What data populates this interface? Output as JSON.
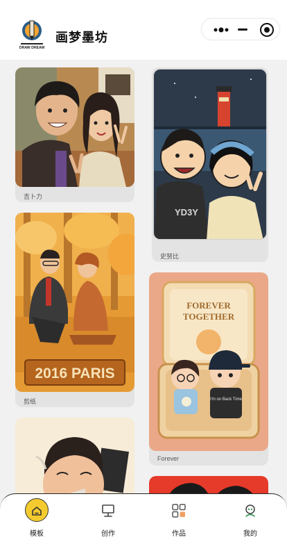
{
  "app": {
    "title": "画梦墨坊",
    "logo_text": "DRAW DREAM"
  },
  "capsule": {
    "more_icon": "more-dots-icon",
    "minimize_icon": "minimize-icon",
    "close_icon": "close-target-icon"
  },
  "gallery": {
    "left": [
      {
        "caption": "吉卜力"
      },
      {
        "caption": "剪纸",
        "poster_text": "2016 PARIS"
      },
      {
        "caption": ""
      }
    ],
    "right": [
      {
        "caption": "史努比",
        "shirt_text": "YD3Y"
      },
      {
        "caption": "Forever",
        "box_title_1": "FOREVER",
        "box_title_2": "TOGETHER",
        "shirt_text": "I'm on Back Time"
      },
      {
        "caption": ""
      }
    ]
  },
  "tabbar": {
    "items": [
      {
        "label": "模板",
        "icon": "home-icon",
        "active": true
      },
      {
        "label": "创作",
        "icon": "easel-icon"
      },
      {
        "label": "作品",
        "icon": "grid-icon"
      },
      {
        "label": "我的",
        "icon": "user-icon"
      }
    ],
    "accent": "#f4cb2e"
  }
}
